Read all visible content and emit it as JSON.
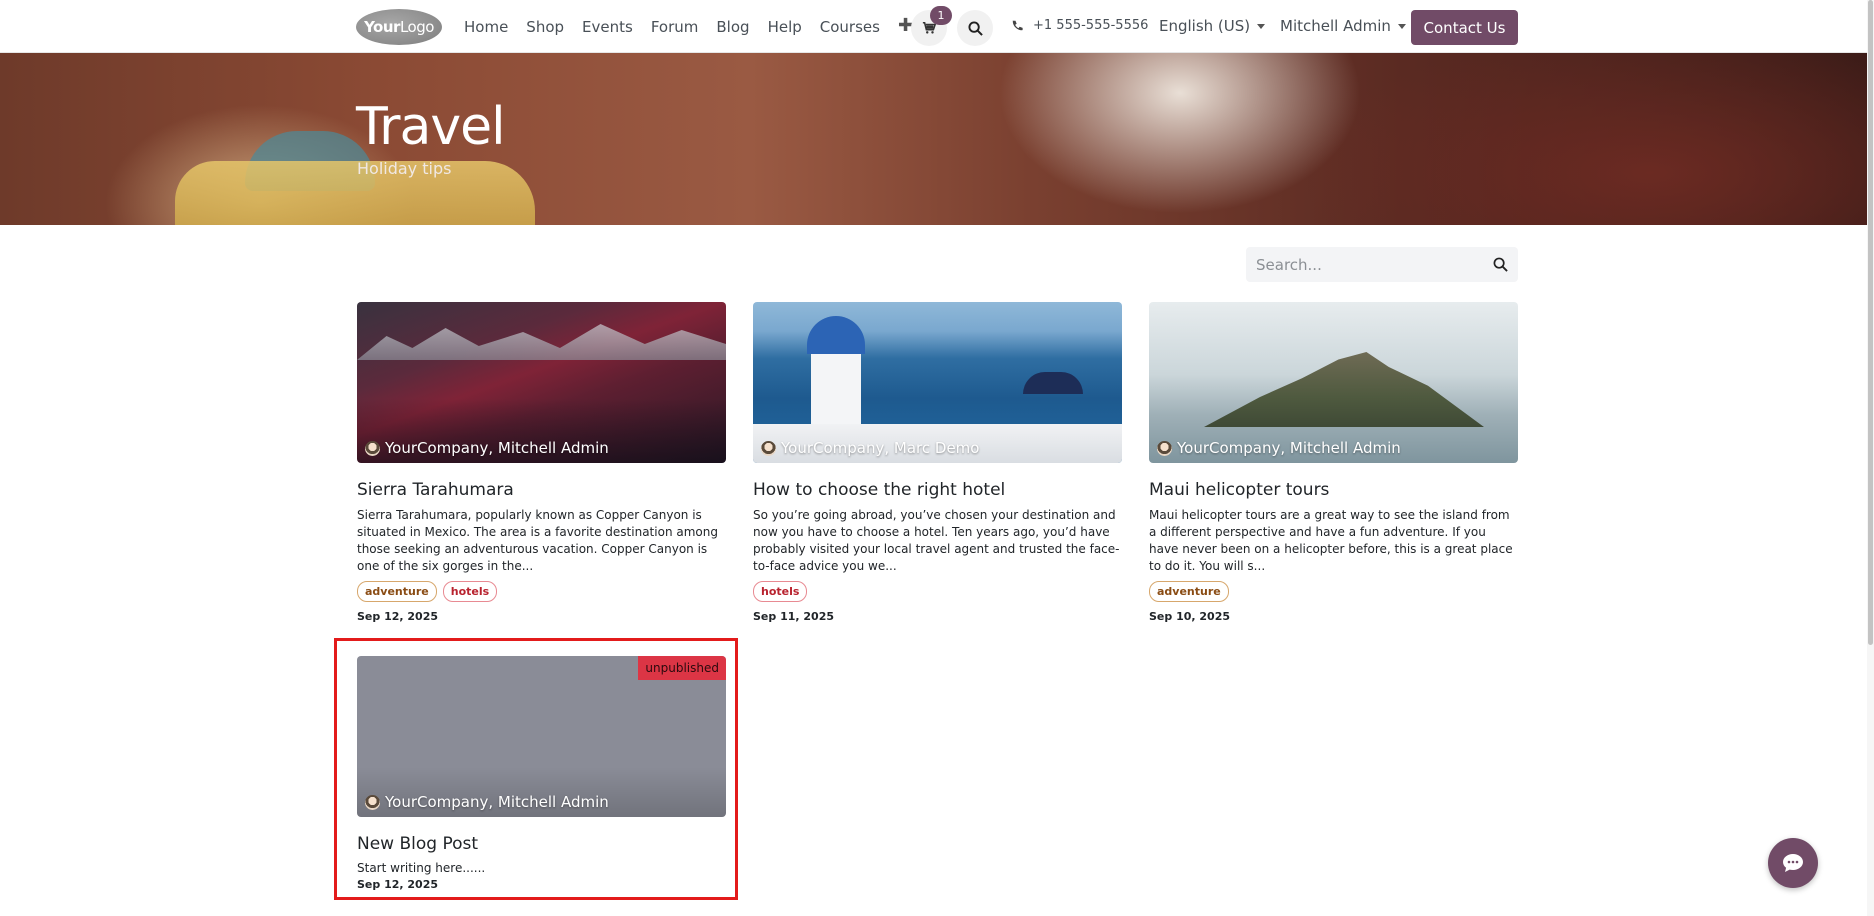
{
  "header": {
    "logo_text_bold": "Your",
    "logo_text": "Logo",
    "nav": [
      "Home",
      "Shop",
      "Events",
      "Forum",
      "Blog",
      "Help",
      "Courses"
    ],
    "plus_icon": "plus-icon",
    "cart_count": "1",
    "phone": "+1 555-555-5556",
    "language": "English (US)",
    "user": "Mitchell Admin",
    "contact_button": "Contact Us",
    "accent_color": "#714b67"
  },
  "hero": {
    "title": "Travel",
    "subtitle": "Holiday tips"
  },
  "search": {
    "placeholder": "Search..."
  },
  "posts": [
    {
      "author": "YourCompany, Mitchell Admin",
      "title": "Sierra Tarahumara",
      "excerpt": "Sierra Tarahumara, popularly known as Copper Canyon is situated in Mexico. The area is a favorite destination among those seeking an adventurous vacation. Copper Canyon is one of the six gorges in the...",
      "tags": [
        "adventure",
        "hotels"
      ],
      "date": "Sep 12, 2025"
    },
    {
      "author": "YourCompany, Marc Demo",
      "title": "How to choose the right hotel",
      "excerpt": "So you’re going abroad, you’ve chosen your destination and now you have to choose a hotel. Ten years ago, you’d have probably visited your local travel agent and trusted the face-to-face advice you we...",
      "tags": [
        "hotels"
      ],
      "date": "Sep 11, 2025"
    },
    {
      "author": "YourCompany, Mitchell Admin",
      "title": "Maui helicopter tours",
      "excerpt": "Maui helicopter tours are a great way to see the island from a different perspective and have a fun adventure. If you have never been on a helicopter before, this is a great place to do it. You will s...",
      "tags": [
        "adventure"
      ],
      "date": "Sep 10, 2025"
    },
    {
      "author": "YourCompany, Mitchell Admin",
      "title": "New Blog Post",
      "excerpt": "Start writing here......",
      "tags": [],
      "date": "Sep 12, 2025",
      "status": "unpublished"
    }
  ]
}
